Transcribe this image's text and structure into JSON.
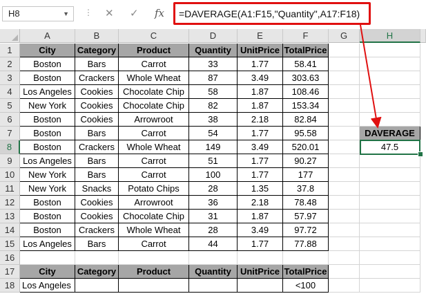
{
  "formula_bar": {
    "namebox": "H8",
    "fx_label": "fx",
    "cancel_glyph": "✕",
    "enter_glyph": "✓",
    "formula": "=DAVERAGE(A1:F15,\"Quantity\",A17:F18)"
  },
  "columns": [
    "A",
    "B",
    "C",
    "D",
    "E",
    "F",
    "G",
    "H"
  ],
  "rows": [
    "1",
    "2",
    "3",
    "4",
    "5",
    "6",
    "7",
    "8",
    "9",
    "10",
    "11",
    "12",
    "13",
    "14",
    "15",
    "16",
    "17",
    "18"
  ],
  "table": {
    "headers": [
      "City",
      "Category",
      "Product",
      "Quantity",
      "UnitPrice",
      "TotalPrice"
    ],
    "rows": [
      [
        "Boston",
        "Bars",
        "Carrot",
        "33",
        "1.77",
        "58.41"
      ],
      [
        "Boston",
        "Crackers",
        "Whole Wheat",
        "87",
        "3.49",
        "303.63"
      ],
      [
        "Los Angeles",
        "Cookies",
        "Chocolate Chip",
        "58",
        "1.87",
        "108.46"
      ],
      [
        "New York",
        "Cookies",
        "Chocolate Chip",
        "82",
        "1.87",
        "153.34"
      ],
      [
        "Boston",
        "Cookies",
        "Arrowroot",
        "38",
        "2.18",
        "82.84"
      ],
      [
        "Boston",
        "Bars",
        "Carrot",
        "54",
        "1.77",
        "95.58"
      ],
      [
        "Boston",
        "Crackers",
        "Whole Wheat",
        "149",
        "3.49",
        "520.01"
      ],
      [
        "Los Angeles",
        "Bars",
        "Carrot",
        "51",
        "1.77",
        "90.27"
      ],
      [
        "New York",
        "Bars",
        "Carrot",
        "100",
        "1.77",
        "177"
      ],
      [
        "New York",
        "Snacks",
        "Potato Chips",
        "28",
        "1.35",
        "37.8"
      ],
      [
        "Boston",
        "Cookies",
        "Arrowroot",
        "36",
        "2.18",
        "78.48"
      ],
      [
        "Boston",
        "Cookies",
        "Chocolate Chip",
        "31",
        "1.87",
        "57.97"
      ],
      [
        "Boston",
        "Crackers",
        "Whole Wheat",
        "28",
        "3.49",
        "97.72"
      ],
      [
        "Los Angeles",
        "Bars",
        "Carrot",
        "44",
        "1.77",
        "77.88"
      ]
    ]
  },
  "criteria": {
    "headers": [
      "City",
      "Category",
      "Product",
      "Quantity",
      "UnitPrice",
      "TotalPrice"
    ],
    "row": [
      "Los Angeles",
      "",
      "",
      "",
      "",
      "<100"
    ]
  },
  "result": {
    "label": "DAVERAGE",
    "value": "47.5"
  },
  "colors": {
    "header_fill": "#a6a6a6",
    "highlight_border": "#e01010",
    "selection": "#217346"
  }
}
